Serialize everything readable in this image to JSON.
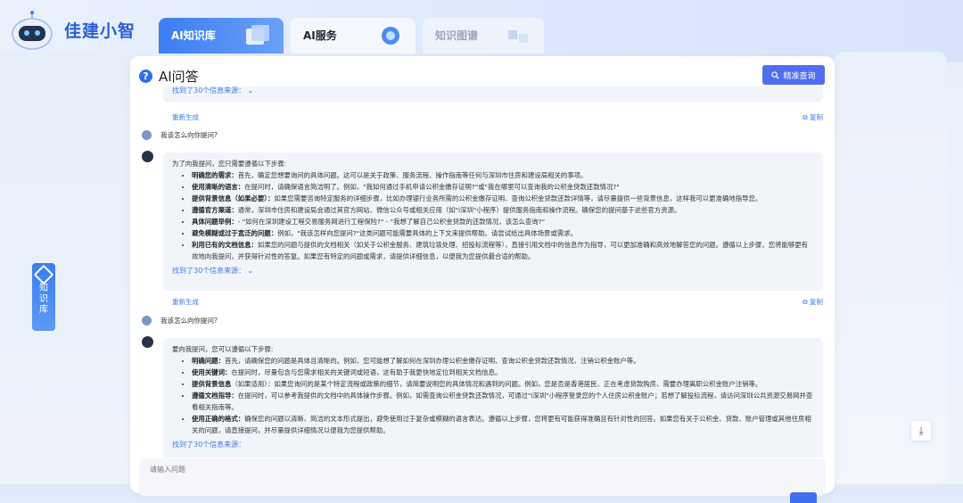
{
  "app": {
    "brand": "佳建小智"
  },
  "tabs": [
    {
      "label": "AI知识库",
      "active": true
    },
    {
      "label": "AI服务",
      "active": false
    },
    {
      "label": "知识图谱",
      "active": false
    }
  ],
  "panel": {
    "title": "AI问答",
    "search_button": "精准查询"
  },
  "side_tab": {
    "chars": [
      "知",
      "识",
      "库"
    ]
  },
  "chat": {
    "top_source": "找到了30个信息来源：",
    "regenerate": "重新生成",
    "copy": "复制",
    "q1": "我该怎么向你提问?",
    "a1": {
      "intro": "为了向我提问，您只需要遵循以下步骤:",
      "items": [
        {
          "head": "明确您的需求：",
          "text": "首先，确定您想要询问的具体问题。这可以是关于政策、服务流程、操作指南等任何与深圳市住房和建设局相关的事项。"
        },
        {
          "head": "使用清晰的语言：",
          "text": "在提问时，请确保语言简洁明了。例如，\"我如何通过手机申请公积金缴存证明?\"或\"我在哪里可以查询我的公积金贷款还款情况?\""
        },
        {
          "head": "提供背景信息（如果必要）：",
          "text": "如果您需要咨询特定服务的详细步骤，比如办理银行业务所需的公积金缴存证明、查询公积金贷款还款详情等，请尽量提供一些背景信息，这样我可以更准确地指导您。"
        },
        {
          "head": "遵循官方渠道：",
          "text": "通常，深圳市住房和建设局会通过其官方网站、微信公众号或相关应用（如\"i深圳\"小程序）提供服务指南和操作流程。确保您的提问基于这些官方资源。"
        },
        {
          "head": "具体问题举例：",
          "text": "- \"如何在深圳建设工程交易服务网进行工程保险?\" - \"我想了解自己公积金贷款的还款情况，该怎么查询?\""
        },
        {
          "head": "避免模糊或过于宽泛的问题：",
          "text": "例如，\"我该怎样向您提问?\"这类问题可能需要具体的上下文来提供帮助。请尝试给出具体场景或需求。"
        },
        {
          "head": "利用已有的文档信息：",
          "text": "如果您的问题与提供的文档相关（如关于公积金服务、建筑垃圾处理、招投标流程等），直接引用文档中的信息作为指导，可以更加准确和高效地解答您的问题。遵循以上步骤，您将能够更有效地向我提问，并获得针对性的答复。如果您有特定的问题或需求，请提供详细信息，以便我为您提供最合适的帮助。"
        }
      ],
      "source": "找到了30个信息来源："
    },
    "q2": "我该怎么向你提问?",
    "a2": {
      "intro": "要向我提问，您可以遵循以下步骤:",
      "items": [
        {
          "head": "明确问题：",
          "text": "首先，请确保您的问题是具体且清晰的。例如，您可能想了解如何在深圳办理公积金缴存证明、查询公积金贷款还款情况、注销公积金账户等。"
        },
        {
          "head": "使用关键词：",
          "text": "在提问时，尽量包含与您需求相关的关键词或短语，这有助于我更快地定位到相关文档信息。"
        },
        {
          "head": "提供背景信息",
          "text": "（如果适用）：如果您询问的是某个特定流程或政策的细节，请简要说明您的具体情况和遇到的问题。例如，您是否是香港居民、正在考虑贷款购房、需要办理离职公积金账户注销等。"
        },
        {
          "head": "遵循文档指导：",
          "text": "在提问时，可以参考我提供的文档中的具体操作步骤。例如，如需查询公积金贷款还款情况，可通过\"i深圳\"小程序登录您的个人住房公积金账户；若想了解投标流程，请访问深圳公共资源交易网并查看相关指南等。"
        },
        {
          "head": "使用正确的格式：",
          "text": "确保您的问题以清晰、简洁的文本形式提出，避免使用过于复杂或模糊的语言表达。遵循以上步骤，您将更有可能获得准确且有针对性的回答。如果您有关于公积金、贷款、账户管理或其他住房相关的问题，请直接提问，并尽量提供详细情况以便我为您提供帮助。"
        }
      ],
      "source": "找到了30个信息来源："
    }
  },
  "input": {
    "placeholder": "请输入问题"
  },
  "colors": {
    "accent": "#2f6fe8",
    "button": "#4f6ff0"
  }
}
